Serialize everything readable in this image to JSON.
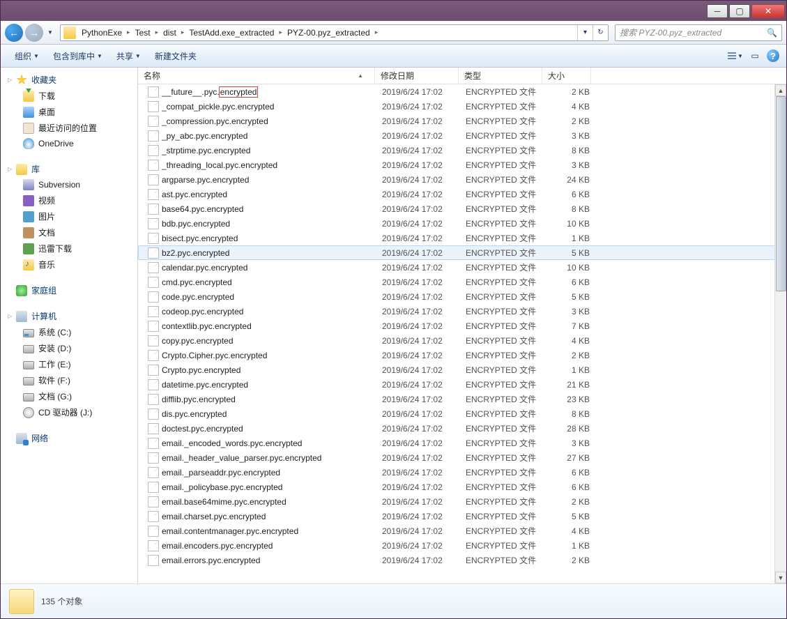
{
  "breadcrumb": [
    "PythonExe",
    "Test",
    "dist",
    "TestAdd.exe_extracted",
    "PYZ-00.pyz_extracted"
  ],
  "search": {
    "placeholder": "搜索 PYZ-00.pyz_extracted"
  },
  "toolbar": {
    "organize": "组织",
    "include": "包含到库中",
    "share": "共享",
    "newfolder": "新建文件夹"
  },
  "columns": {
    "name": "名称",
    "date": "修改日期",
    "type": "类型",
    "size": "大小"
  },
  "sidebar": {
    "favorites": {
      "label": "收藏夹",
      "items": [
        {
          "id": "dl",
          "label": "下载"
        },
        {
          "id": "desk",
          "label": "桌面"
        },
        {
          "id": "recent",
          "label": "最近访问的位置"
        },
        {
          "id": "onedrive",
          "label": "OneDrive"
        }
      ]
    },
    "library": {
      "label": "库",
      "items": [
        {
          "id": "sub",
          "label": "Subversion"
        },
        {
          "id": "vid",
          "label": "视频"
        },
        {
          "id": "pic",
          "label": "图片"
        },
        {
          "id": "doc",
          "label": "文档"
        },
        {
          "id": "xl",
          "label": "迅雷下载"
        },
        {
          "id": "mus",
          "label": "音乐"
        }
      ]
    },
    "homegroup": {
      "label": "家庭组"
    },
    "computer": {
      "label": "计算机",
      "items": [
        {
          "id": "c",
          "label": "系统 (C:)"
        },
        {
          "id": "d",
          "label": "安装 (D:)"
        },
        {
          "id": "e",
          "label": "工作 (E:)"
        },
        {
          "id": "f",
          "label": "软件 (F:)"
        },
        {
          "id": "g",
          "label": "文档 (G:)"
        },
        {
          "id": "j",
          "label": "CD 驱动器 (J:)"
        }
      ]
    },
    "network": {
      "label": "网络"
    }
  },
  "files": [
    {
      "name_pre": "__future__.pyc.",
      "name_hl": "encrypted",
      "date": "2019/6/24 17:02",
      "type": "ENCRYPTED 文件",
      "size": "2 KB",
      "first": true
    },
    {
      "name": "_compat_pickle.pyc.encrypted",
      "date": "2019/6/24 17:02",
      "type": "ENCRYPTED 文件",
      "size": "4 KB"
    },
    {
      "name": "_compression.pyc.encrypted",
      "date": "2019/6/24 17:02",
      "type": "ENCRYPTED 文件",
      "size": "2 KB"
    },
    {
      "name": "_py_abc.pyc.encrypted",
      "date": "2019/6/24 17:02",
      "type": "ENCRYPTED 文件",
      "size": "3 KB"
    },
    {
      "name": "_strptime.pyc.encrypted",
      "date": "2019/6/24 17:02",
      "type": "ENCRYPTED 文件",
      "size": "8 KB"
    },
    {
      "name": "_threading_local.pyc.encrypted",
      "date": "2019/6/24 17:02",
      "type": "ENCRYPTED 文件",
      "size": "3 KB"
    },
    {
      "name": "argparse.pyc.encrypted",
      "date": "2019/6/24 17:02",
      "type": "ENCRYPTED 文件",
      "size": "24 KB"
    },
    {
      "name": "ast.pyc.encrypted",
      "date": "2019/6/24 17:02",
      "type": "ENCRYPTED 文件",
      "size": "6 KB"
    },
    {
      "name": "base64.pyc.encrypted",
      "date": "2019/6/24 17:02",
      "type": "ENCRYPTED 文件",
      "size": "8 KB"
    },
    {
      "name": "bdb.pyc.encrypted",
      "date": "2019/6/24 17:02",
      "type": "ENCRYPTED 文件",
      "size": "10 KB"
    },
    {
      "name": "bisect.pyc.encrypted",
      "date": "2019/6/24 17:02",
      "type": "ENCRYPTED 文件",
      "size": "1 KB"
    },
    {
      "name": "bz2.pyc.encrypted",
      "date": "2019/6/24 17:02",
      "type": "ENCRYPTED 文件",
      "size": "5 KB",
      "hover": true
    },
    {
      "name": "calendar.pyc.encrypted",
      "date": "2019/6/24 17:02",
      "type": "ENCRYPTED 文件",
      "size": "10 KB"
    },
    {
      "name": "cmd.pyc.encrypted",
      "date": "2019/6/24 17:02",
      "type": "ENCRYPTED 文件",
      "size": "6 KB"
    },
    {
      "name": "code.pyc.encrypted",
      "date": "2019/6/24 17:02",
      "type": "ENCRYPTED 文件",
      "size": "5 KB"
    },
    {
      "name": "codeop.pyc.encrypted",
      "date": "2019/6/24 17:02",
      "type": "ENCRYPTED 文件",
      "size": "3 KB"
    },
    {
      "name": "contextlib.pyc.encrypted",
      "date": "2019/6/24 17:02",
      "type": "ENCRYPTED 文件",
      "size": "7 KB"
    },
    {
      "name": "copy.pyc.encrypted",
      "date": "2019/6/24 17:02",
      "type": "ENCRYPTED 文件",
      "size": "4 KB"
    },
    {
      "name": "Crypto.Cipher.pyc.encrypted",
      "date": "2019/6/24 17:02",
      "type": "ENCRYPTED 文件",
      "size": "2 KB"
    },
    {
      "name": "Crypto.pyc.encrypted",
      "date": "2019/6/24 17:02",
      "type": "ENCRYPTED 文件",
      "size": "1 KB"
    },
    {
      "name": "datetime.pyc.encrypted",
      "date": "2019/6/24 17:02",
      "type": "ENCRYPTED 文件",
      "size": "21 KB"
    },
    {
      "name": "difflib.pyc.encrypted",
      "date": "2019/6/24 17:02",
      "type": "ENCRYPTED 文件",
      "size": "23 KB"
    },
    {
      "name": "dis.pyc.encrypted",
      "date": "2019/6/24 17:02",
      "type": "ENCRYPTED 文件",
      "size": "8 KB"
    },
    {
      "name": "doctest.pyc.encrypted",
      "date": "2019/6/24 17:02",
      "type": "ENCRYPTED 文件",
      "size": "28 KB"
    },
    {
      "name": "email._encoded_words.pyc.encrypted",
      "date": "2019/6/24 17:02",
      "type": "ENCRYPTED 文件",
      "size": "3 KB"
    },
    {
      "name": "email._header_value_parser.pyc.encrypted",
      "date": "2019/6/24 17:02",
      "type": "ENCRYPTED 文件",
      "size": "27 KB"
    },
    {
      "name": "email._parseaddr.pyc.encrypted",
      "date": "2019/6/24 17:02",
      "type": "ENCRYPTED 文件",
      "size": "6 KB"
    },
    {
      "name": "email._policybase.pyc.encrypted",
      "date": "2019/6/24 17:02",
      "type": "ENCRYPTED 文件",
      "size": "6 KB"
    },
    {
      "name": "email.base64mime.pyc.encrypted",
      "date": "2019/6/24 17:02",
      "type": "ENCRYPTED 文件",
      "size": "2 KB"
    },
    {
      "name": "email.charset.pyc.encrypted",
      "date": "2019/6/24 17:02",
      "type": "ENCRYPTED 文件",
      "size": "5 KB"
    },
    {
      "name": "email.contentmanager.pyc.encrypted",
      "date": "2019/6/24 17:02",
      "type": "ENCRYPTED 文件",
      "size": "4 KB"
    },
    {
      "name": "email.encoders.pyc.encrypted",
      "date": "2019/6/24 17:02",
      "type": "ENCRYPTED 文件",
      "size": "1 KB"
    },
    {
      "name": "email.errors.pyc.encrypted",
      "date": "2019/6/24 17:02",
      "type": "ENCRYPTED 文件",
      "size": "2 KB"
    }
  ],
  "status": {
    "count": "135 个对象"
  }
}
